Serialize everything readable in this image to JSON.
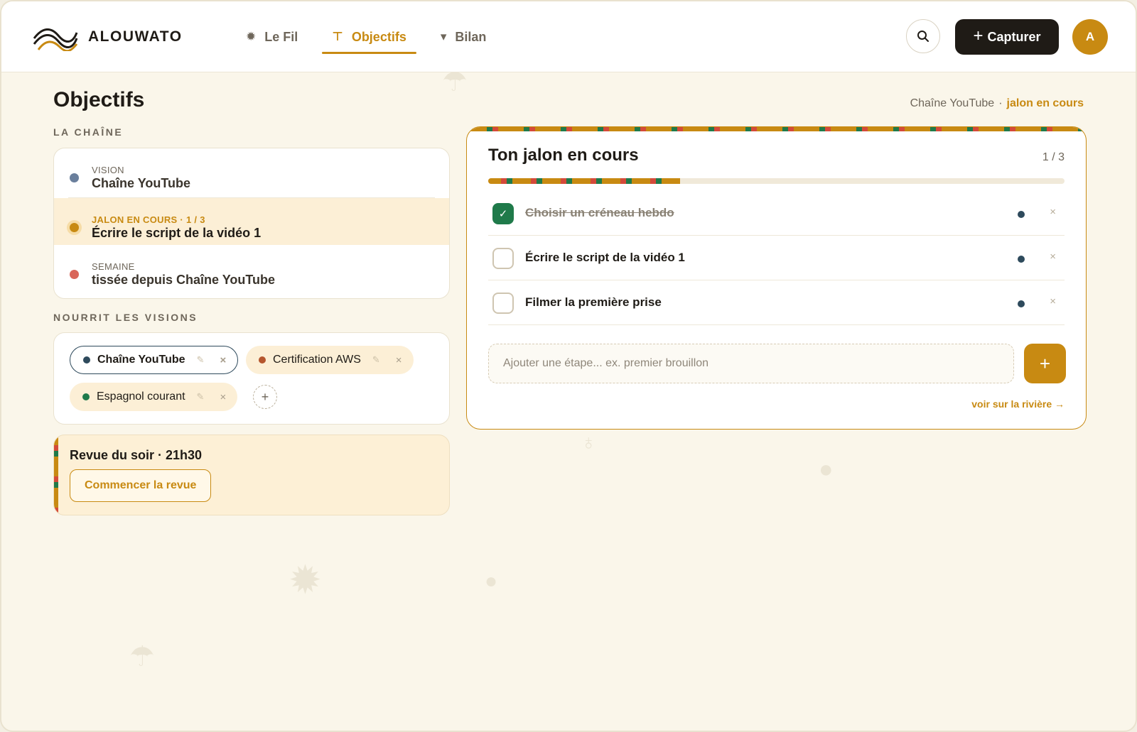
{
  "app": {
    "name": "ALOUWATO"
  },
  "nav": {
    "items": [
      {
        "label": "Le Fil",
        "icon": "sun-icon"
      },
      {
        "label": "Objectifs",
        "icon": "mushroom-icon",
        "active": true
      },
      {
        "label": "Bilan",
        "icon": "torch-icon"
      }
    ]
  },
  "header": {
    "capture_label": "Capturer",
    "avatar_initial": "A"
  },
  "page": {
    "title": "Objectifs",
    "breadcrumb_parent": "Chaîne YouTube",
    "breadcrumb_sep": "·",
    "breadcrumb_current": "jalon en cours"
  },
  "chain": {
    "section_label": "LA CHAÎNE",
    "rows": [
      {
        "kicker": "VISION",
        "value": "Chaîne YouTube",
        "color": "#6a7f9c"
      },
      {
        "kicker": "JALON EN COURS · 1 / 3",
        "value": "Écrire le script de la vidéo 1",
        "color": "#c88a12"
      },
      {
        "kicker": "SEMAINE",
        "value": "tissée depuis Chaîne YouTube",
        "color": "#d9665a"
      }
    ]
  },
  "visions": {
    "section_label": "NOURRIT LES VISIONS",
    "chips": [
      {
        "label": "Chaîne YouTube",
        "color": "#2e4a5c",
        "selected": true
      },
      {
        "label": "Certification AWS",
        "color": "#b5562e",
        "selected": false
      },
      {
        "label": "Espagnol courant",
        "color": "#1f7a4a",
        "selected": false
      }
    ],
    "edit_glyph": "✎",
    "remove_glyph": "×",
    "add_glyph": "+"
  },
  "revue": {
    "title": "Revue du soir · 21h30",
    "button_label": "Commencer la revue"
  },
  "jalon": {
    "title": "Ton jalon en cours",
    "count": "1 / 3",
    "progress": 0.333,
    "tasks": [
      {
        "label": "Choisir un créneau hebdo",
        "done": true
      },
      {
        "label": "Écrire le script de la vidéo 1",
        "done": false
      },
      {
        "label": "Filmer la première prise",
        "done": false
      }
    ],
    "check_glyph": "✓",
    "remove_glyph": "×",
    "add_placeholder": "Ajouter une étape... ex. premier brouillon",
    "add_glyph": "+",
    "river_link": "voir sur la rivière →"
  },
  "colors": {
    "accent": "#c88a12",
    "ink": "#1f1b16",
    "success": "#1f7a4a",
    "background": "#faf6ea"
  }
}
